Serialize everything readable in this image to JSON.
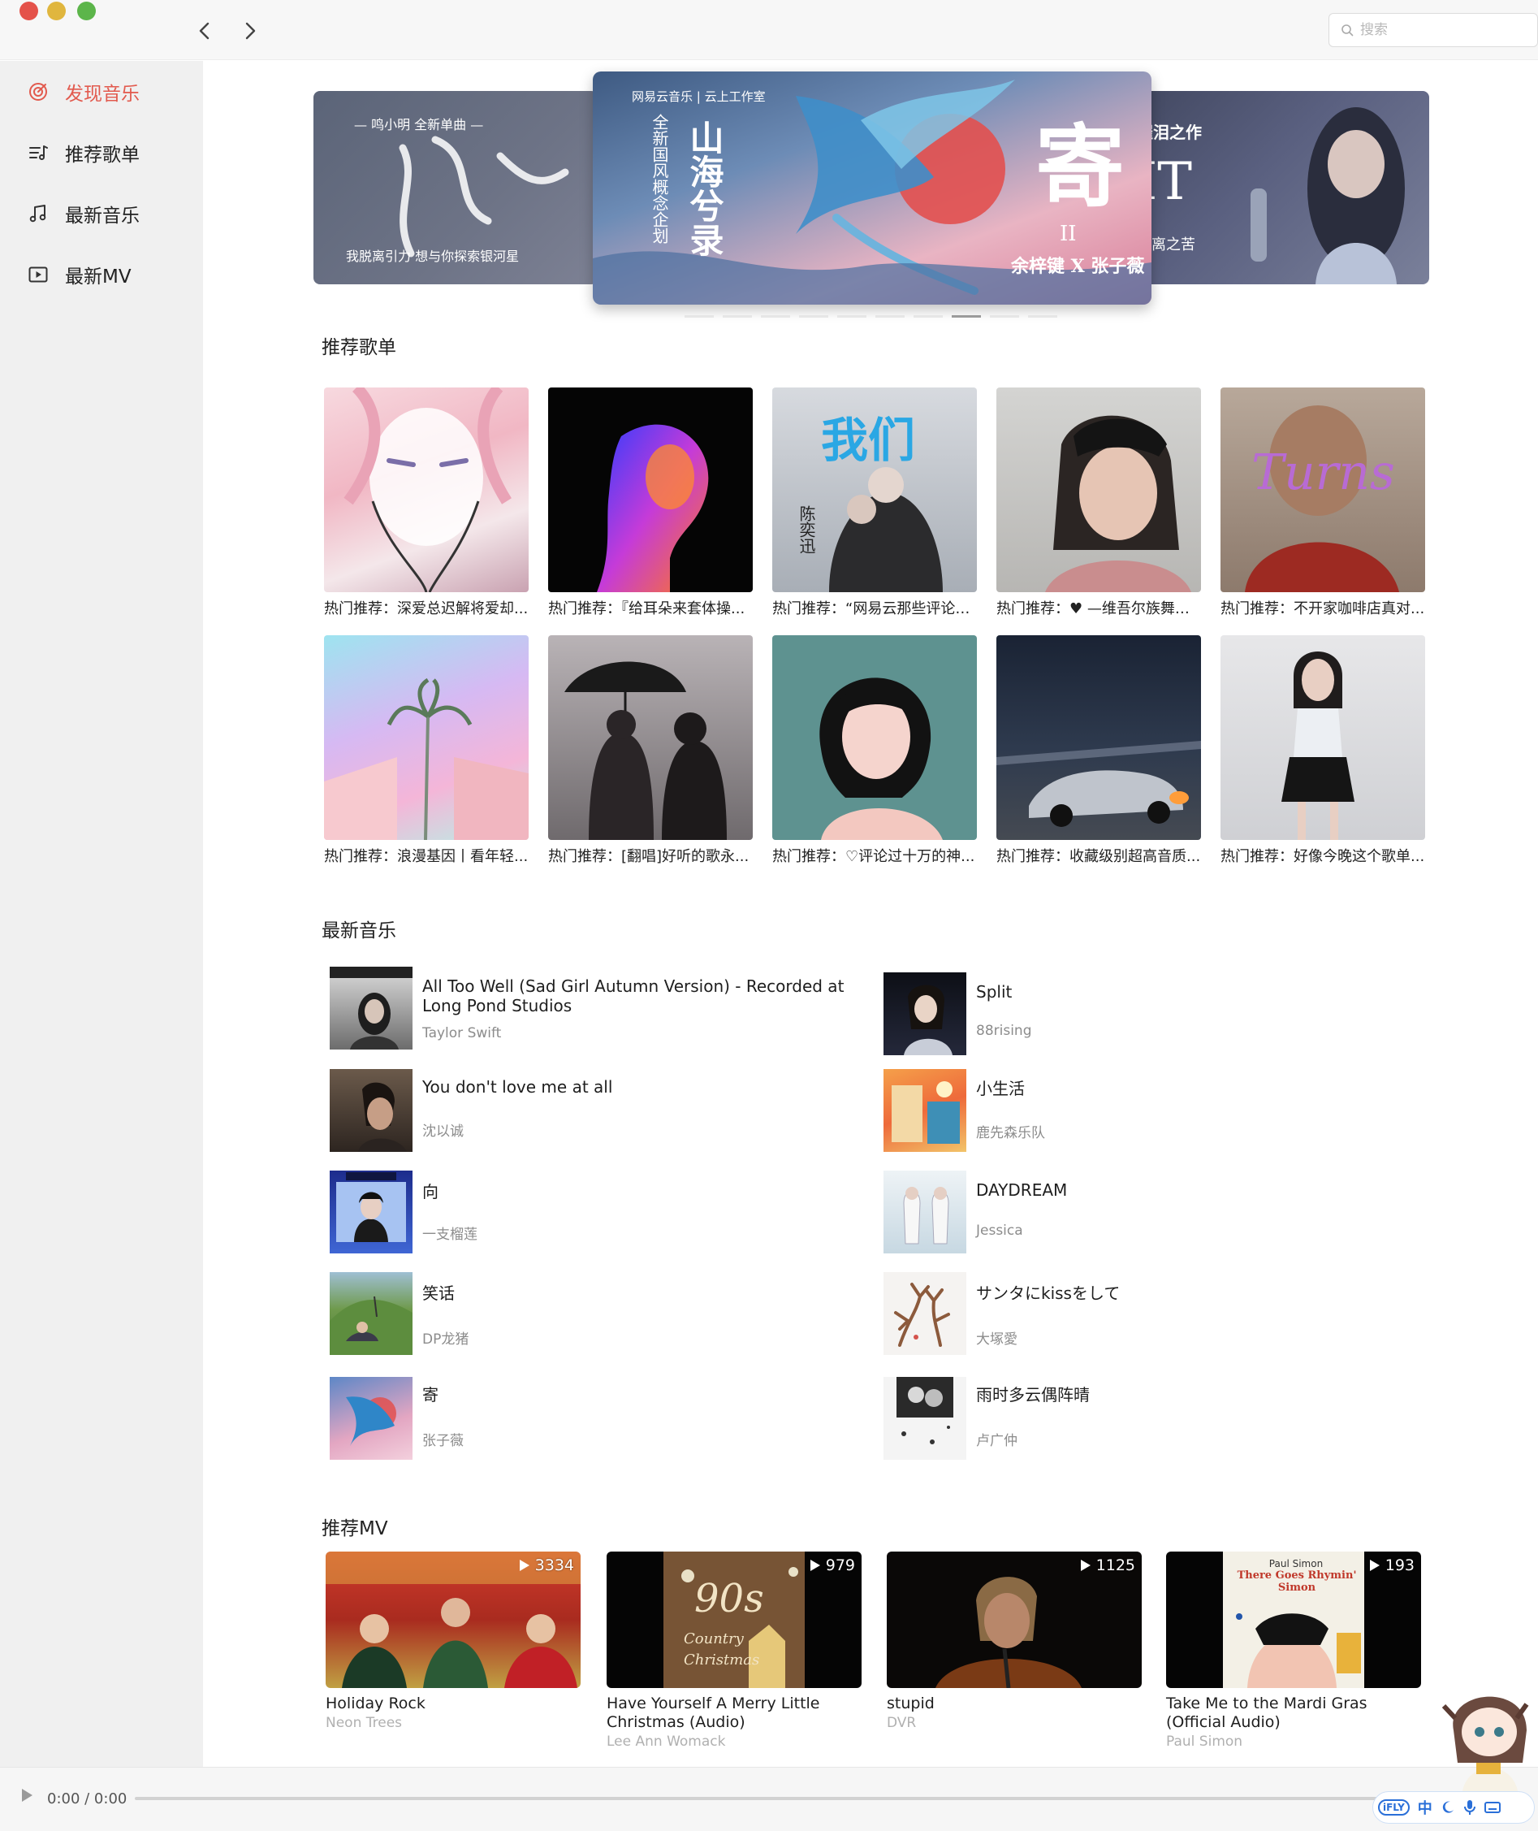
{
  "window": {
    "nav_back_icon": "chevron-left-icon",
    "nav_forward_icon": "chevron-right-icon"
  },
  "search": {
    "placeholder": "搜索",
    "value": ""
  },
  "sidebar": {
    "items": [
      {
        "label": "发现音乐",
        "icon": "radar-icon",
        "active": true
      },
      {
        "label": "推荐歌单",
        "icon": "playlist-icon",
        "active": false
      },
      {
        "label": "最新音乐",
        "icon": "music-note-icon",
        "active": false
      },
      {
        "label": "最新MV",
        "icon": "video-icon",
        "active": false
      }
    ]
  },
  "banner": {
    "left": {
      "line1": "— 鸣小明  全新单曲 —",
      "calligraphy": "引力",
      "line2": "我脱离引力  想与你探索银河星"
    },
    "center": {
      "brand": "网易云音乐 | 云上工作室",
      "side": "全新国风概念企划",
      "calligraphy": "山海兮录",
      "right_char": "寄",
      "roman": "II",
      "artists": "余梓键 X 张子薇"
    },
    "right": {
      "line1": "催泪之作",
      "big": "IT",
      "line2": "分离之苦"
    },
    "dot_count": 10,
    "active_dot": 7
  },
  "playlists": {
    "title": "推荐歌单",
    "items": [
      {
        "name": "热门推荐：深爱总迟解将爱却..."
      },
      {
        "name": "热门推荐：『给耳朵来套体操..."
      },
      {
        "name": "热门推荐：“网易云那些评论1..."
      },
      {
        "name": "热门推荐：♥ —维吾尔族舞蹈 ..."
      },
      {
        "name": "热门推荐：不开家咖啡店真对..."
      },
      {
        "name": "热门推荐：浪漫基因丨看年轻..."
      },
      {
        "name": "热门推荐：[翻唱]好听的歌永..."
      },
      {
        "name": "热门推荐：♡评论过十万的神..."
      },
      {
        "name": "热门推荐：收藏级别超高音质..."
      },
      {
        "name": "热门推荐：好像今晚这个歌单..."
      }
    ],
    "cover_texts": {
      "third": "我们",
      "third_sub": "陈奕迅",
      "fifth": "Turns"
    }
  },
  "new_songs": {
    "title": "最新音乐",
    "left": [
      {
        "title": "All Too Well (Sad Girl Autumn Version) - Recorded at Long Pond Studios",
        "artist": "Taylor Swift"
      },
      {
        "title": "You don't love me at all",
        "artist": "沈以诚"
      },
      {
        "title": "向",
        "artist": "一支榴莲"
      },
      {
        "title": "笑话",
        "artist": "DP龙猪"
      },
      {
        "title": "寄",
        "artist": "张子薇"
      }
    ],
    "right": [
      {
        "title": "Split",
        "artist": "88rising"
      },
      {
        "title": "小生活",
        "artist": "鹿先森乐队"
      },
      {
        "title": "DAYDREAM",
        "artist": "Jessica"
      },
      {
        "title": "サンタにkissをして",
        "artist": "大塚愛"
      },
      {
        "title": "雨时多云偶阵晴",
        "artist": "卢广仲"
      }
    ]
  },
  "mvs": {
    "title": "推荐MV",
    "items": [
      {
        "title": "Holiday Rock",
        "artist": "Neon Trees",
        "plays": "3334"
      },
      {
        "title": "Have Yourself A Merry Little Christmas (Audio)",
        "artist": "Lee Ann Womack",
        "plays": "979",
        "cover_text": "90s",
        "cover_sub": "Country Christmas"
      },
      {
        "title": "stupid",
        "artist": "DVR",
        "plays": "1125"
      },
      {
        "title": "Take Me to the Mardi Gras (Official Audio)",
        "artist": "Paul Simon",
        "plays": "193",
        "cover_text": "There Goes Rhymin' Simon",
        "cover_small": "Paul Simon"
      }
    ]
  },
  "player": {
    "time": "0:00 / 0:00",
    "progress": 0
  },
  "ime": {
    "brand": "iFLY",
    "mode": "中"
  }
}
